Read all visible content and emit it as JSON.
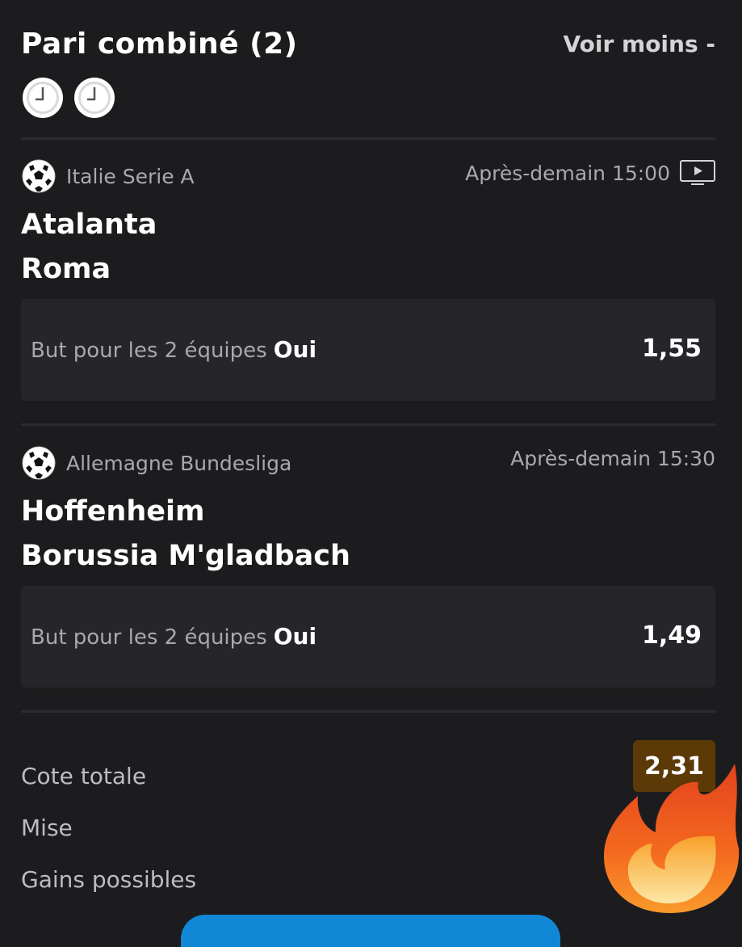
{
  "header": {
    "title": "Pari combiné (2)",
    "toggle_label": "Voir moins -"
  },
  "status_icons": [
    "clock-icon",
    "clock-icon"
  ],
  "events": [
    {
      "sport_icon": "soccer-ball-icon",
      "league": "Italie Serie A",
      "time": "Après-demain 15:00",
      "live_stream_icon": "tv-play-icon",
      "home_team": "Atalanta",
      "away_team": "Roma",
      "market": "But pour les 2 équipes",
      "pick": "Oui",
      "odd": "1,55"
    },
    {
      "sport_icon": "soccer-ball-icon",
      "league": "Allemagne Bundesliga",
      "time": "Après-demain 15:30",
      "home_team": "Hoffenheim",
      "away_team": "Borussia M'gladbach",
      "market": "But pour les 2 équipes",
      "pick": "Oui",
      "odd": "1,49"
    }
  ],
  "summary": {
    "total_odds_label": "Cote totale",
    "total_odds_value": "2,31",
    "stake_label": "Mise",
    "potential_gain_label": "Gains possibles"
  },
  "colors": {
    "background": "#1c1c1e",
    "card": "#25252a",
    "badge": "#5b3a07",
    "button": "#1287d6"
  }
}
